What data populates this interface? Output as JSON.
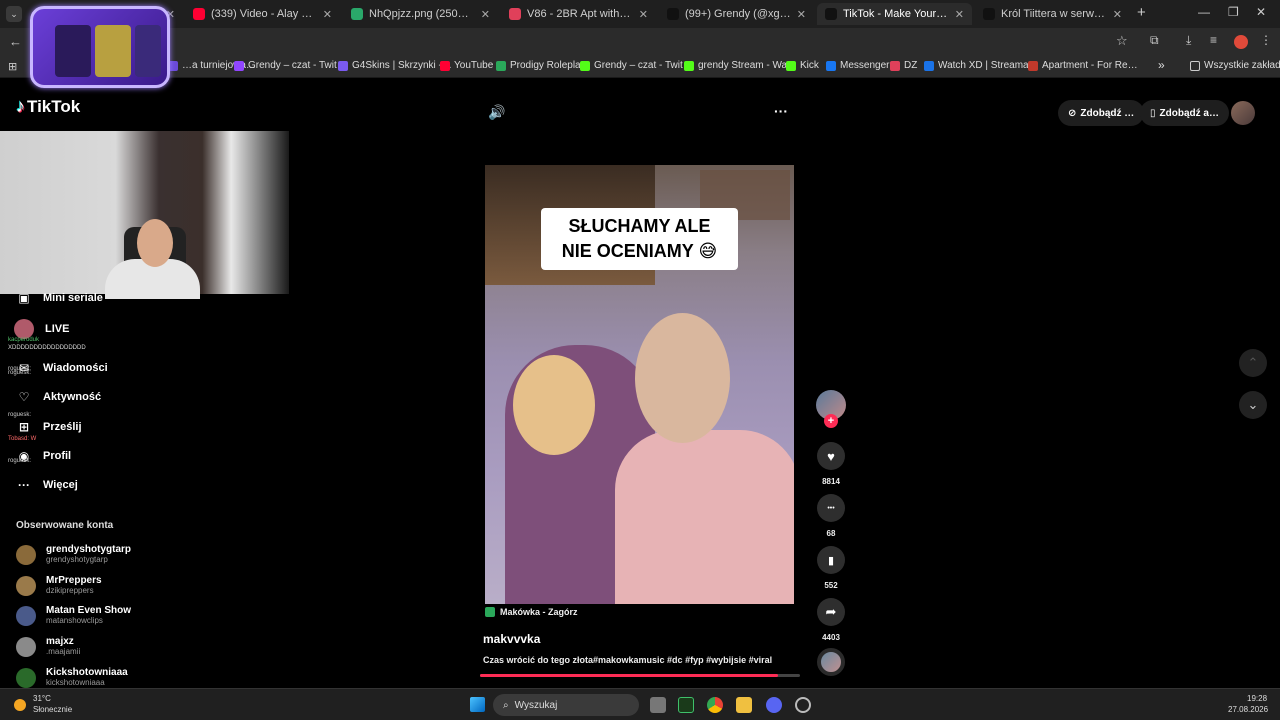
{
  "browser": {
    "tabs": [
      {
        "title": "",
        "color": "#1a73e8",
        "active": false
      },
      {
        "title": "(339) Video - Alay 2016 - YouTube",
        "color": "#ff0033",
        "active": false
      },
      {
        "title": "NhQpjzz.png (250×354)",
        "color": "#2aa86a",
        "active": false
      },
      {
        "title": "V86 - 2BR Apt with Stunning G…",
        "color": "#e0405a",
        "active": false
      },
      {
        "title": "(99+) Grendy (@xgrendy) | TikTok",
        "color": "#111111",
        "active": false
      },
      {
        "title": "TikTok - Make Your Day",
        "color": "#111111",
        "active": true
      },
      {
        "title": "Król Tiittera w serwisie X: „Czte…",
        "color": "#111111",
        "active": false
      }
    ],
    "new_tab": "+",
    "window_controls": {
      "minimize": "—",
      "restore": "❐",
      "close": "✕"
    },
    "bookmarks": [
      {
        "label": "…a turniejowa…",
        "color": "#6a4ad8"
      },
      {
        "label": "Grendy – czat - Twit…",
        "color": "#9146ff"
      },
      {
        "label": "G4Skins | Skrzynki -…",
        "color": "#7a5af0"
      },
      {
        "label": "YouTube",
        "color": "#ff0033"
      },
      {
        "label": "Prodigy Roleplay",
        "color": "#2aa85a"
      },
      {
        "label": "Grendy – czat - Twit…",
        "color": "#53fc18"
      },
      {
        "label": "grendy Stream - Wa…",
        "color": "#53fc18"
      },
      {
        "label": "Kick",
        "color": "#53fc18"
      },
      {
        "label": "Messenger",
        "color": "#1877f2"
      },
      {
        "label": "DZ",
        "color": "#e0405a"
      },
      {
        "label": "Watch XD | Streama…",
        "color": "#1a73e8"
      },
      {
        "label": "Apartment - For Re…",
        "color": "#c0392b"
      }
    ],
    "bookmarks_more": "»",
    "all_bookmarks": "Wszystkie zakładki"
  },
  "sidebar": {
    "logo": "TikTok",
    "nav": [
      {
        "label": "Mini seriale",
        "icon": "mini-series-icon",
        "glyph": "▣"
      },
      {
        "label": "LIVE",
        "icon": "live-icon",
        "glyph": "●"
      },
      {
        "label": "Wiadomości",
        "icon": "messages-icon",
        "glyph": "✉"
      },
      {
        "label": "Aktywność",
        "icon": "activity-icon",
        "glyph": "♡"
      },
      {
        "label": "Prześlij",
        "icon": "upload-icon",
        "glyph": "⊞"
      },
      {
        "label": "Profil",
        "icon": "profile-icon",
        "glyph": "◉"
      },
      {
        "label": "Więcej",
        "icon": "more-icon",
        "glyph": "···"
      }
    ],
    "followed_title": "Obserwowane konta",
    "accounts": [
      {
        "name": "grendyshotygtarp",
        "user": "grendyshotygtarp",
        "color": "#8a6a3a"
      },
      {
        "name": "MrPreppers",
        "user": "dzikipreppers",
        "color": "#9a7a4a"
      },
      {
        "name": "Matan Even Show",
        "user": "matanshowclips",
        "color": "#4a5a8a"
      },
      {
        "name": "majxz",
        "user": ".maajamii",
        "color": "#8a8a8a"
      },
      {
        "name": "Kickshotowniaaa",
        "user": "kickshotowniaaa",
        "color": "#2a6a2a"
      }
    ]
  },
  "chat_overlay": [
    {
      "text": "kacperoduk",
      "color": "#53c06a"
    },
    {
      "text": "XDDDDDDDDDDDDDDDDD",
      "color": "#dddddd"
    },
    {
      "text": "roguesk:",
      "color": "#cccccc"
    },
    {
      "text": "roguesk:",
      "color": "#cccccc"
    },
    {
      "text": "roguesk:",
      "color": "#cccccc"
    },
    {
      "text": "Tobasd: W",
      "color": "#ff6a6a"
    },
    {
      "text": "roguesk:",
      "color": "#cccccc"
    }
  ],
  "player": {
    "volume_icon": "🔊",
    "more_icon": "···",
    "video_caption_line1": "SŁUCHAMY ALE",
    "video_caption_line2": "NIE OCENIAMY 😅",
    "music": "Makówka - Zagórz",
    "author": "makvvvka",
    "description": "Czas wrócić do tego złota#makowkamusic #dc #fyp #wybijsie #viral",
    "progress": 0.93
  },
  "actions": {
    "follow_plus": "+",
    "like_glyph": "♥",
    "likes": "8814",
    "comment_glyph": "•••",
    "comments": "68",
    "save_glyph": "▮",
    "saves": "552",
    "share_glyph": "➦",
    "shares": "4403"
  },
  "top_right": {
    "btn1": "Zdobądź …",
    "btn2": "Zdobądź a…"
  },
  "nav_arrows": {
    "up": "⌃",
    "down": "⌄"
  },
  "taskbar": {
    "temp": "31°C",
    "weather": "Słonecznie",
    "search": "Wyszukaj",
    "time": "19:28",
    "date": "27.08.2026"
  }
}
